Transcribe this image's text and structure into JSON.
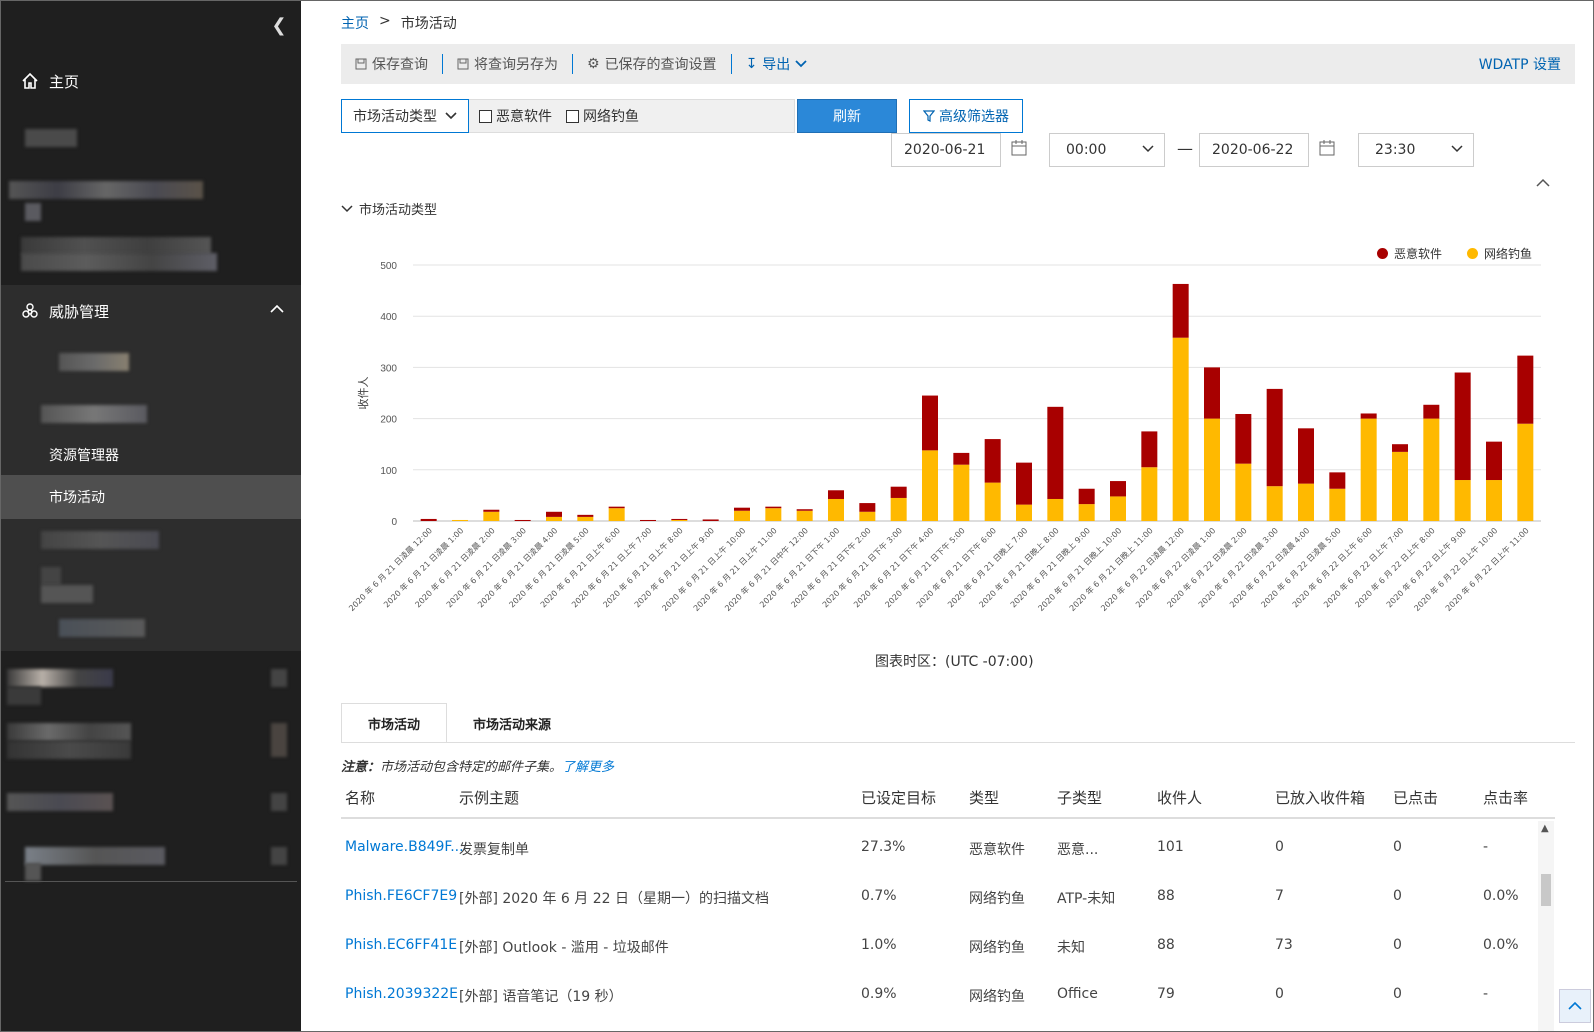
{
  "sidebar": {
    "home_label": "主页",
    "threat_label": "威胁管理",
    "explorer_label": "资源管理器",
    "campaigns_label": "市场活动"
  },
  "breadcrumb": {
    "home": "主页",
    "sep": ">",
    "current": "市场活动"
  },
  "toolbar": {
    "save_query": "保存查询",
    "save_as": "将查询另存为",
    "saved_settings": "已保存的查询设置",
    "export": "导出",
    "wdatp": "WDATP 设置"
  },
  "filters": {
    "type_dropdown": "市场活动类型",
    "malware": "恶意软件",
    "phish": "网络钓鱼",
    "refresh": "刷新",
    "advanced": "高级筛选器",
    "start_date": "2020-06-21",
    "start_time": "00:00",
    "dash": "—",
    "end_date": "2020-06-22",
    "end_time": "23:30"
  },
  "section_title": "市场活动类型",
  "chart_footer": "图表时区：(UTC -07:00)",
  "colors": {
    "malware": "#a80000",
    "phish": "#ffb900",
    "accent": "#0078d4"
  },
  "chart_data": {
    "type": "bar",
    "stacked": true,
    "ylabel": "收件人",
    "ylim": [
      0,
      500
    ],
    "yticks": [
      "0",
      "100",
      "200",
      "300",
      "400",
      "500"
    ],
    "legend_position": "top-right",
    "grid": true,
    "categories": [
      "2020 年 6 月 21 日凌晨 12:00",
      "2020 年 6 月 21 日凌晨 1:00",
      "2020 年 6 月 21 日凌晨 2:00",
      "2020 年 6 月 21 日凌晨 3:00",
      "2020 年 6 月 21 日凌晨 4:00",
      "2020 年 6 月 21 日凌晨 5:00",
      "2020 年 6 月 21 日上午 6:00",
      "2020 年 6 月 21 日上午 7:00",
      "2020 年 6 月 21 日上午 8:00",
      "2020 年 6 月 21 日上午 9:00",
      "2020 年 6 月 21 日上午 10:00",
      "2020 年 6 月 21 日上午 11:00",
      "2020 年 6 月 21 日中午 12:00",
      "2020 年 6 月 21 日下午 1:00",
      "2020 年 6 月 21 日下午 2:00",
      "2020 年 6 月 21 日下午 3:00",
      "2020 年 6 月 21 日下午 4:00",
      "2020 年 6 月 21 日下午 5:00",
      "2020 年 6 月 21 日下午 6:00",
      "2020 年 6 月 21 日晚上 7:00",
      "2020 年 6 月 21 日晚上 8:00",
      "2020 年 6 月 21 日晚上 9:00",
      "2020 年 6 月 21 日晚上 10:00",
      "2020 年 6 月 21 日晚上 11:00",
      "2020 年 6 月 22 日凌晨 12:00",
      "2020 年 6 月 22 日凌晨 1:00",
      "2020 年 6 月 22 日凌晨 2:00",
      "2020 年 6 月 22 日凌晨 3:00",
      "2020 年 6 月 22 日凌晨 4:00",
      "2020 年 6 月 22 日凌晨 5:00",
      "2020 年 6 月 22 日上午 6:00",
      "2020 年 6 月 22 日上午 7:00",
      "2020 年 6 月 22 日上午 8:00",
      "2020 年 6 月 22 日上午 9:00",
      "2020 年 6 月 22 日上午 10:00",
      "2020 年 6 月 22 日上午 11:00"
    ],
    "series": [
      {
        "name": "网络钓鱼",
        "values": [
          0,
          2,
          18,
          0,
          8,
          8,
          25,
          0,
          2,
          0,
          20,
          25,
          20,
          43,
          18,
          45,
          138,
          110,
          75,
          32,
          43,
          33,
          48,
          105,
          358,
          200,
          112,
          68,
          73,
          63,
          200,
          135,
          200,
          80,
          80,
          190
        ]
      },
      {
        "name": "恶意软件",
        "values": [
          4,
          0,
          4,
          2,
          10,
          4,
          3,
          2,
          2,
          3,
          6,
          3,
          3,
          17,
          17,
          22,
          107,
          23,
          85,
          82,
          180,
          30,
          30,
          70,
          105,
          100,
          97,
          190,
          108,
          32,
          10,
          15,
          27,
          210,
          75,
          133
        ]
      }
    ]
  },
  "tabs": [
    "市场活动",
    "市场活动来源"
  ],
  "note": {
    "prefix": "注意：",
    "text": "市场活动包含特定的邮件子集。",
    "link": "了解更多"
  },
  "table": {
    "headers": [
      "名称",
      "示例主题",
      "已设定目标",
      "类型",
      "子类型",
      "收件人",
      "已放入收件箱",
      "已点击",
      "点击率"
    ],
    "rows": [
      [
        "Malware.B849F...",
        "发票复制单",
        "27.3%",
        "恶意软件",
        "恶意...",
        "101",
        "0",
        "0",
        "-"
      ],
      [
        "Phish.FE6CF7E9",
        "[外部] 2020 年 6 月 22 日（星期一）的扫描文档",
        "0.7%",
        "网络钓鱼",
        "ATP-未知",
        "88",
        "7",
        "0",
        "0.0%"
      ],
      [
        "Phish.EC6FF41E",
        "[外部] Outlook - 滥用 - 垃圾邮件",
        "1.0%",
        "网络钓鱼",
        "未知",
        "88",
        "73",
        "0",
        "0.0%"
      ],
      [
        "Phish.2039322E",
        "[外部] 语音笔记（19 秒）",
        "0.9%",
        "网络钓鱼",
        "Office",
        "79",
        "0",
        "0",
        "-"
      ]
    ]
  }
}
